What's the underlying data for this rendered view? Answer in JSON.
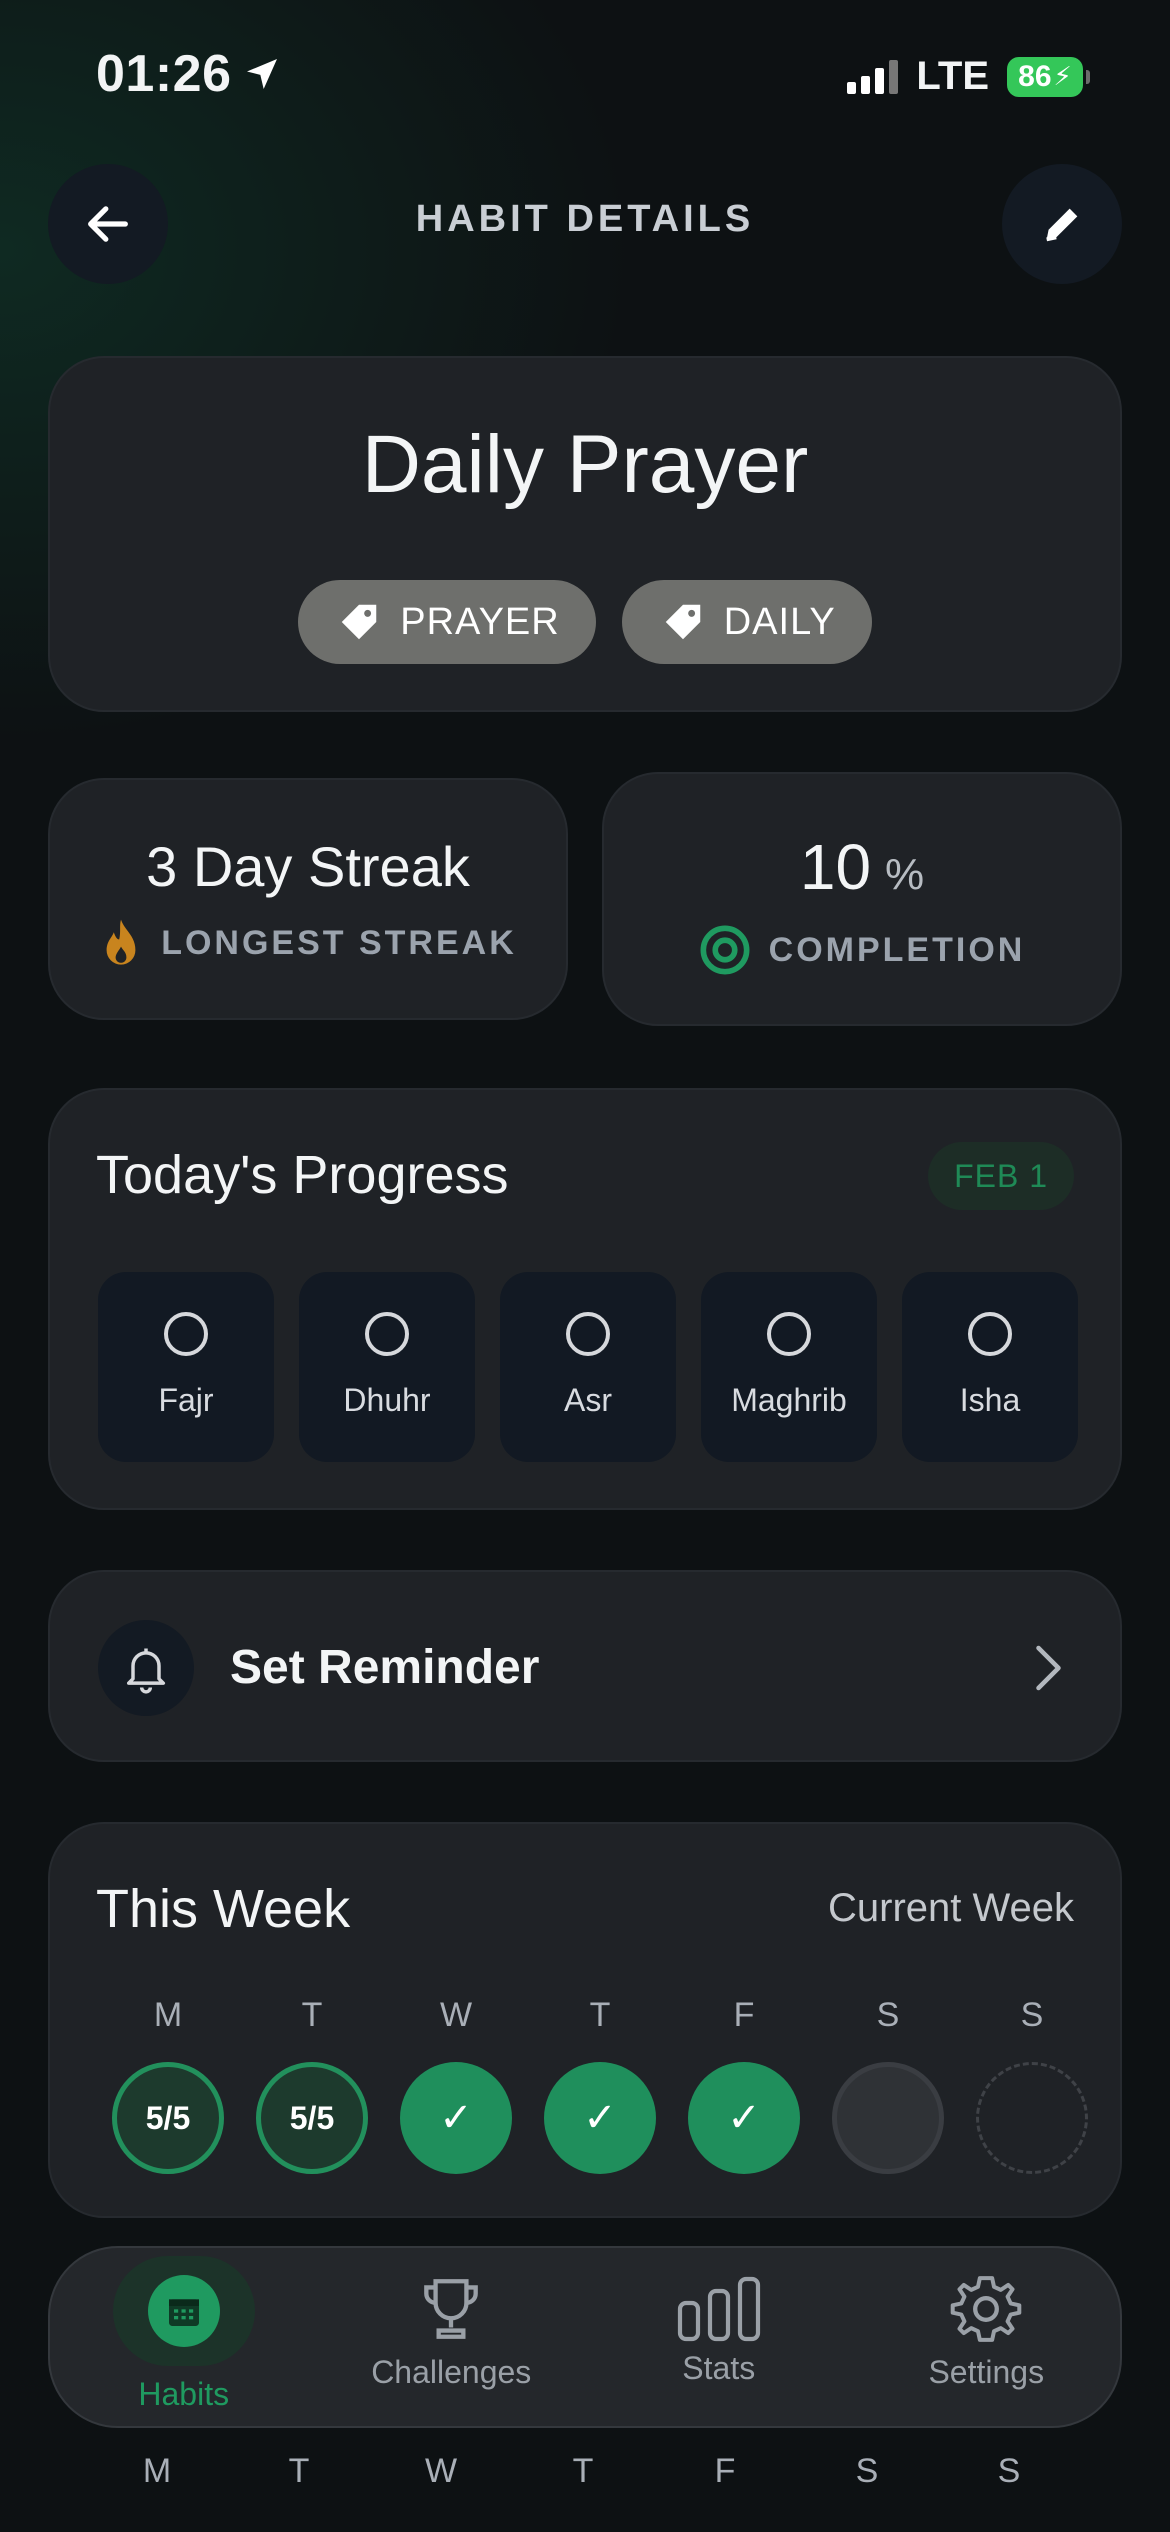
{
  "status_bar": {
    "time": "01:26",
    "network": "LTE",
    "battery": "86"
  },
  "header": {
    "title": "HABIT DETAILS"
  },
  "habit": {
    "name": "Daily Prayer",
    "tags": [
      "PRAYER",
      "DAILY"
    ]
  },
  "stats": {
    "streak_value": "3 Day Streak",
    "streak_label": "LONGEST STREAK",
    "completion_value": "10",
    "completion_unit": "%",
    "completion_label": "COMPLETION"
  },
  "progress": {
    "title": "Today's Progress",
    "date": "FEB 1",
    "prayers": [
      "Fajr",
      "Dhuhr",
      "Asr",
      "Maghrib",
      "Isha"
    ]
  },
  "reminder": {
    "label": "Set Reminder"
  },
  "week": {
    "title": "This Week",
    "subtitle": "Current Week",
    "days": [
      "M",
      "T",
      "W",
      "T",
      "F",
      "S",
      "S"
    ],
    "statuses": [
      {
        "state": "partial",
        "text": "5/5"
      },
      {
        "state": "partial",
        "text": "5/5"
      },
      {
        "state": "done",
        "text": "✓"
      },
      {
        "state": "done",
        "text": "✓"
      },
      {
        "state": "done",
        "text": "✓"
      },
      {
        "state": "missed",
        "text": ""
      },
      {
        "state": "future",
        "text": ""
      }
    ]
  },
  "tabbar": {
    "items": [
      {
        "label": "Habits",
        "icon": "calendar-icon",
        "active": true
      },
      {
        "label": "Challenges",
        "icon": "trophy-icon",
        "active": false
      },
      {
        "label": "Stats",
        "icon": "bar-chart-icon",
        "active": false
      },
      {
        "label": "Settings",
        "icon": "gear-icon",
        "active": false
      }
    ]
  },
  "bottom_days": [
    "M",
    "T",
    "W",
    "T",
    "F",
    "S",
    "S"
  ],
  "colors": {
    "accent": "#1f9a60",
    "background": "#0d1113",
    "card": "#1f2226"
  }
}
